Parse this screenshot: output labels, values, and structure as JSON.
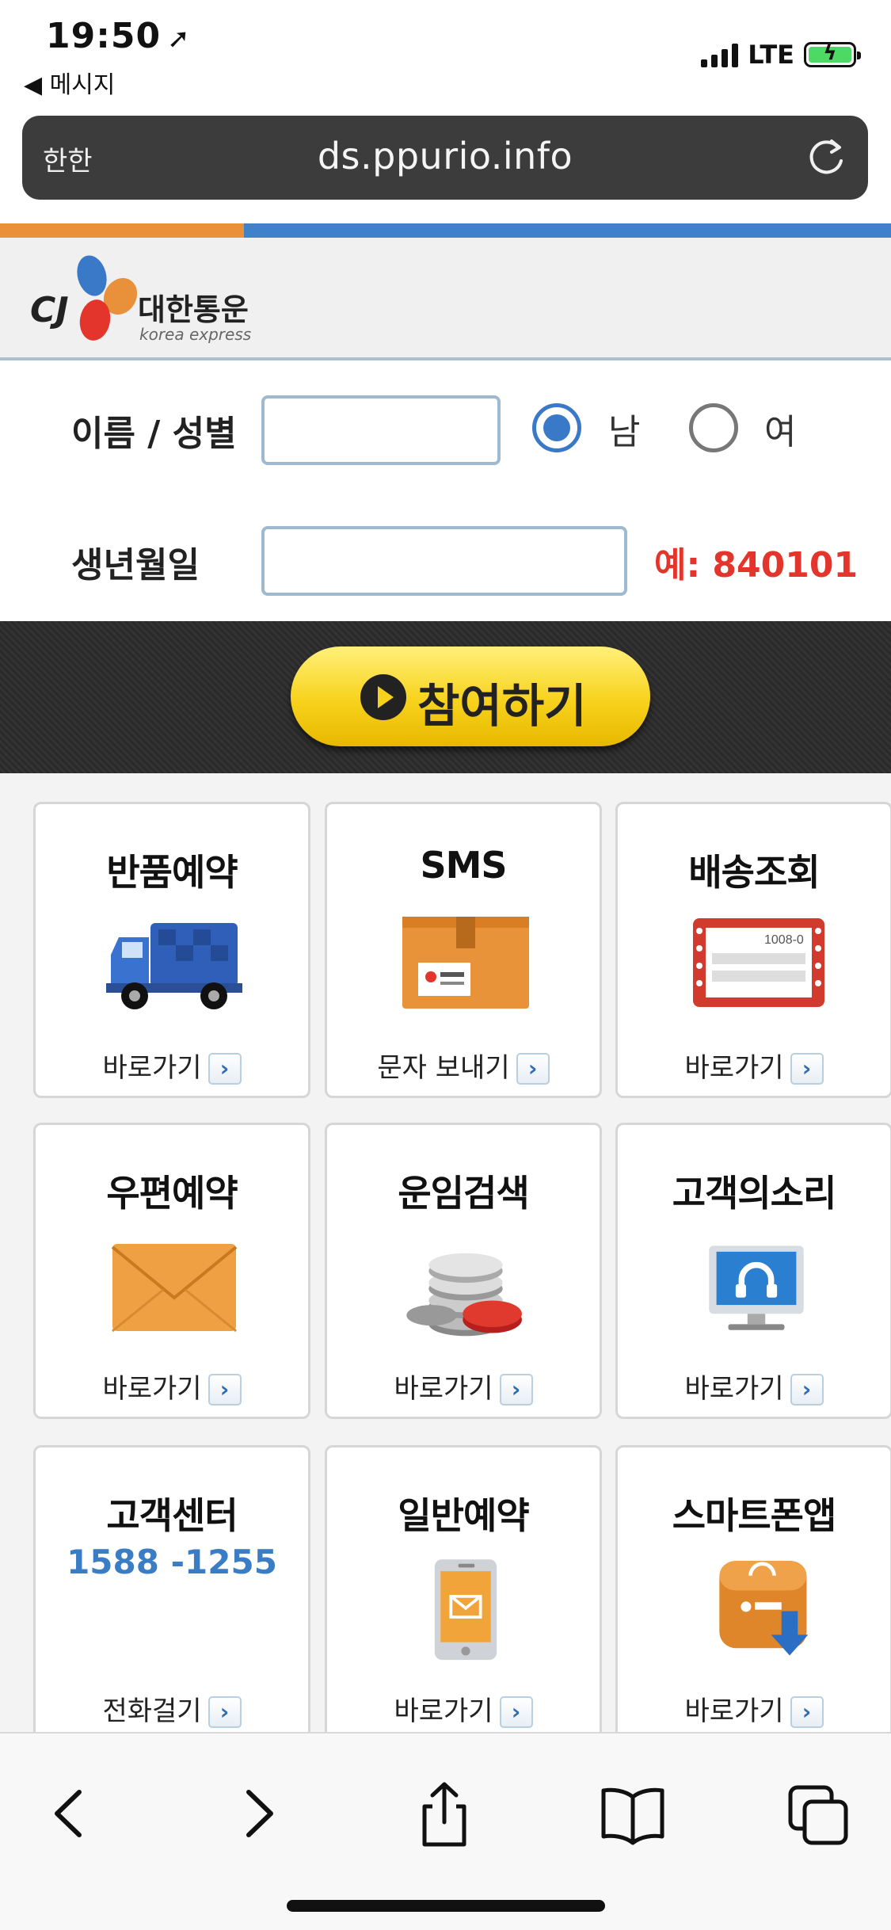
{
  "status_bar": {
    "time": "19:50",
    "back_label": "◀ 메시지",
    "network": "LTE"
  },
  "browser": {
    "text_size_label": "한한",
    "url": "ds.ppurio.info"
  },
  "header": {
    "logo_mark": "CJ",
    "logo_name": "대한통운",
    "logo_sub": "korea express"
  },
  "form": {
    "name_gender_label": "이름 / 성별",
    "name_value": "",
    "gender_options": [
      "남",
      "여"
    ],
    "gender_selected": "남",
    "dob_label": "생년월일",
    "dob_value": "",
    "dob_example": "예: 840101"
  },
  "cta": {
    "label": "참여하기"
  },
  "tiles": [
    {
      "title": "반품예약",
      "link": "바로가기",
      "icon": "truck-icon"
    },
    {
      "title": "SMS",
      "link": "문자 보내기",
      "icon": "box-icon"
    },
    {
      "title": "배송조회",
      "link": "바로가기",
      "icon": "tracking-card-icon",
      "icon_text": "1008-0"
    },
    {
      "title": "우편예약",
      "link": "바로가기",
      "icon": "envelope-icon"
    },
    {
      "title": "운임검색",
      "link": "바로가기",
      "icon": "coins-icon"
    },
    {
      "title": "고객의소리",
      "link": "바로가기",
      "icon": "monitor-headset-icon"
    },
    {
      "title": "고객센터",
      "phone": "1588 -1255",
      "link": "전화걸기"
    },
    {
      "title": "일반예약",
      "link": "바로가기",
      "icon": "phone-mail-icon"
    },
    {
      "title": "스마트폰앱",
      "link": "바로가기",
      "icon": "app-download-icon"
    }
  ],
  "colors": {
    "orange": "#e8903a",
    "blue": "#3f82c9",
    "red": "#e3352b",
    "yellow": "#f7d21c"
  }
}
